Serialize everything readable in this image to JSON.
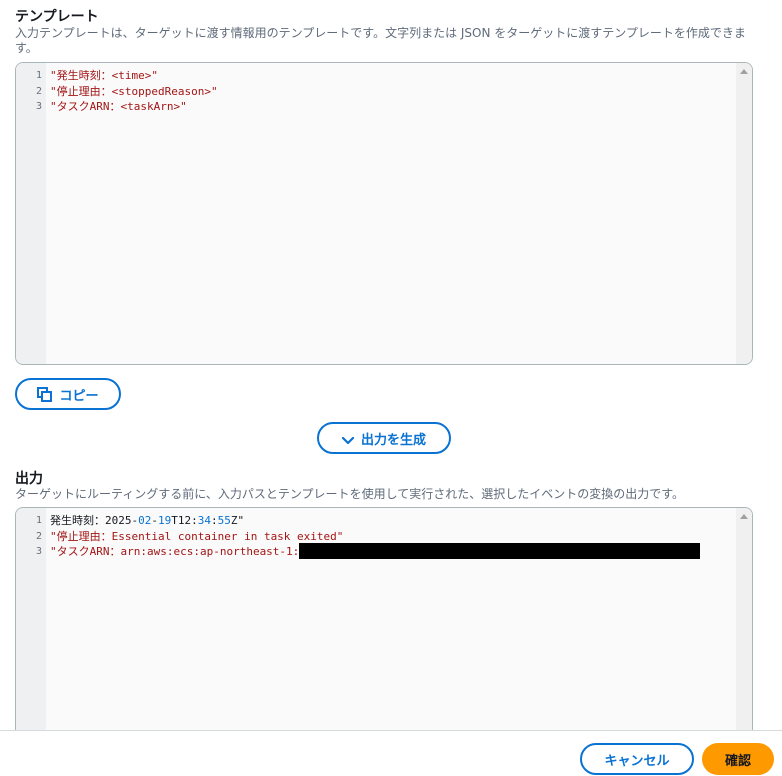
{
  "template_section": {
    "title": "テンプレート",
    "description": "入力テンプレートは、ターゲットに渡す情報用のテンプレートです。文字列または JSON をターゲットに渡すテンプレートを作成できます。",
    "lines": [
      {
        "num": "1",
        "text": "\"発生時刻：<time>\""
      },
      {
        "num": "2",
        "text": "\"停止理由：<stoppedReason>\""
      },
      {
        "num": "3",
        "text": "\"タスクARN：<taskArn>\""
      }
    ],
    "copy_label": "コピー"
  },
  "generate_label": "出力を生成",
  "output_section": {
    "title": "出力",
    "description": "ターゲットにルーティングする前に、入力パスとテンプレートを使用して実行された、選択したイベントの変換の出力です。",
    "lines": [
      {
        "num": "1",
        "parts": [
          {
            "text": "発生時刻：2025-",
            "cls": "plain"
          },
          {
            "text": "02",
            "cls": "num"
          },
          {
            "text": "-",
            "cls": "plain"
          },
          {
            "text": "19",
            "cls": "num"
          },
          {
            "text": "T12:",
            "cls": "plain"
          },
          {
            "text": "34",
            "cls": "num"
          },
          {
            "text": ":",
            "cls": "plain"
          },
          {
            "text": "55",
            "cls": "num"
          },
          {
            "text": "Z\"",
            "cls": "plain"
          }
        ]
      },
      {
        "num": "2",
        "text": "\"停止理由：Essential container in task exited\""
      },
      {
        "num": "3",
        "text": "\"タスクARN：arn:aws:ecs:ap-northeast-1:"
      }
    ]
  },
  "footer": {
    "cancel_label": "キャンセル",
    "confirm_label": "確認"
  },
  "colors": {
    "accent": "#0972d3",
    "primary": "#ff9900",
    "string": "#a31515"
  }
}
